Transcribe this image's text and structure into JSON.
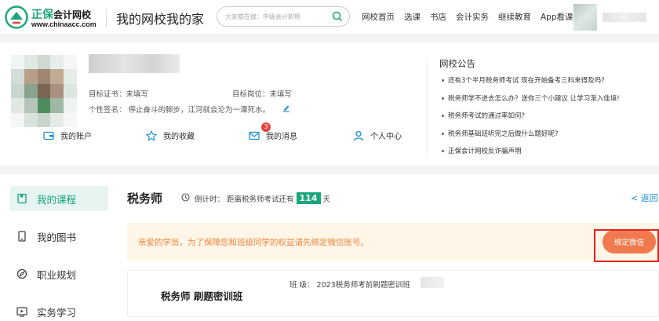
{
  "header": {
    "logo_brand": "正保",
    "logo_sub": "会计网校",
    "logo_url": "www.chinaacc.com",
    "slogan": "我的网校我的家",
    "search_placeholder": "大家都在搜：中级会计职称",
    "nav": [
      "网校首页",
      "选课",
      "书店",
      "会计实务",
      "继续教育",
      "App看课"
    ]
  },
  "profile": {
    "target_cert": "目标证书：未填写",
    "target_post": "目标岗位：未填写",
    "signature": "个性签名：  停止奋斗的脚步，江河就会沦为一潭死水。",
    "shortcuts": [
      {
        "label": "我的账户",
        "icon": "wallet-icon"
      },
      {
        "label": "我的收藏",
        "icon": "star-icon"
      },
      {
        "label": "我的消息",
        "icon": "mail-icon"
      },
      {
        "label": "个人中心",
        "icon": "person-icon"
      }
    ],
    "message_count": "3"
  },
  "notices": {
    "title": "网校公告",
    "items": [
      "还有3个半月税务师考试 现在开始备考三科来得及吗?",
      "税务师学不进去怎么办？送你三个小建议 让学习渐入佳境!",
      "税务师考试的通过率如何?",
      "税务师基础班听完之后做什么题好呢?",
      "正保会计网校反诈骗声明"
    ]
  },
  "sidebar": {
    "items": [
      {
        "label": "我的课程",
        "icon": "book-icon",
        "active": true
      },
      {
        "label": "我的图书",
        "icon": "phone-book-icon",
        "active": false
      },
      {
        "label": "职业规划",
        "icon": "compass-icon",
        "active": false
      },
      {
        "label": "实务学习",
        "icon": "play-icon",
        "active": false
      }
    ]
  },
  "main": {
    "course_title": "税务师",
    "countdown_prefix": "倒计时：  距离税务师考试还有",
    "countdown_days": "114",
    "countdown_suffix": "天",
    "back_label": "< 返回",
    "alert_text": "亲爱的学员，为了保障您和班级同学的权益请先绑定微信账号。",
    "bind_label": "绑定微信",
    "class_name": "税务师 刷题密训班",
    "class_info": "班    级：  2023税务师考前刷题密训班"
  },
  "colors": {
    "brand_green": "#1aa57a",
    "alert_orange": "#f07a4e",
    "highlight_red": "#e5231d",
    "link_blue": "#1a8fd6"
  }
}
